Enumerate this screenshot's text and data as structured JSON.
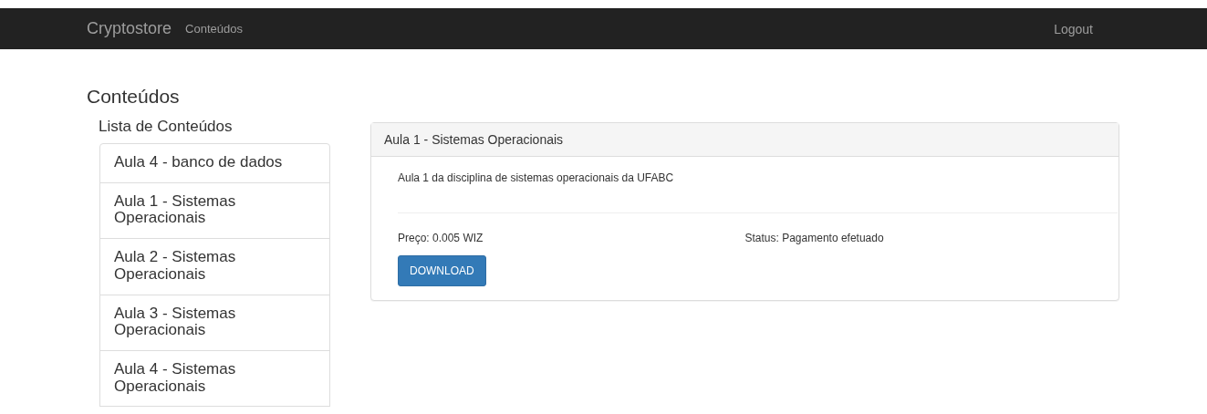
{
  "navbar": {
    "brand": "Cryptostore",
    "links": [
      "Conteúdos"
    ],
    "logout": "Logout"
  },
  "page_title": "Conteúdos",
  "sidebar": {
    "title": "Lista de Conteúdos",
    "items": [
      {
        "label": "Aula 4 - banco de dados"
      },
      {
        "label": "Aula 1 - Sistemas Operacionais"
      },
      {
        "label": "Aula 2 - Sistemas Operacionais"
      },
      {
        "label": "Aula 3 - Sistemas Operacionais"
      },
      {
        "label": "Aula 4 - Sistemas Operacionais"
      }
    ]
  },
  "panel": {
    "title": "Aula 1 - Sistemas Operacionais",
    "description": "Aula 1 da disciplina de sistemas operacionais da UFABC",
    "price": "Preço: 0.005 WIZ",
    "status": "Status: Pagamento efetuado",
    "button": "DOWNLOAD"
  }
}
